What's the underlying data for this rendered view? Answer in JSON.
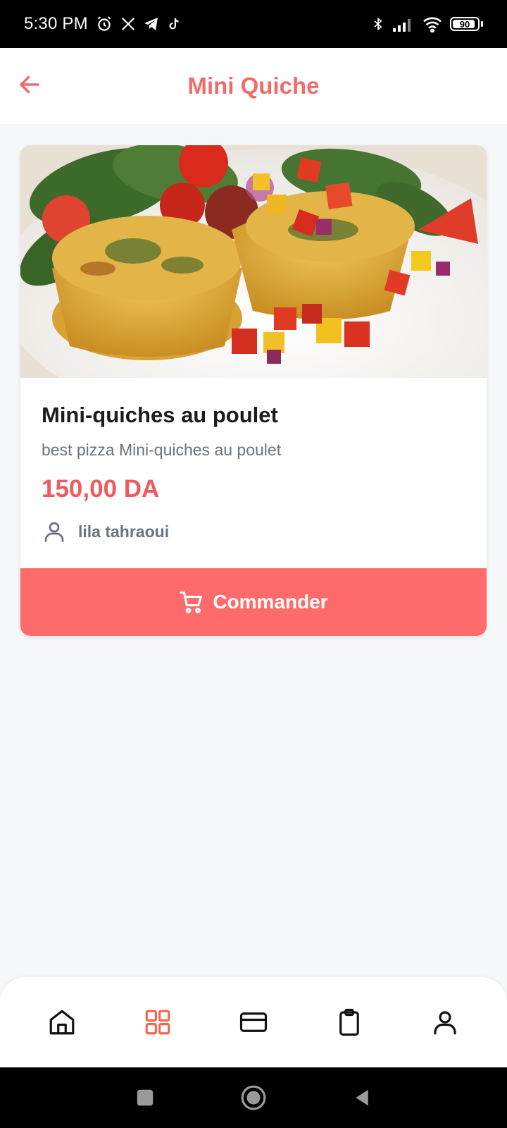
{
  "status_bar": {
    "time": "5:30 PM",
    "battery_level": "90",
    "battery_percent": 90,
    "icons": [
      "alarm-icon",
      "x-icon",
      "telegram-icon",
      "tiktok-icon",
      "bluetooth-icon",
      "signal-icon",
      "wifi-icon",
      "battery-icon"
    ]
  },
  "header": {
    "title": "Mini Quiche",
    "back_icon": "arrow-left-icon"
  },
  "product": {
    "image_icon": "food-photo",
    "name": "Mini-quiches au poulet",
    "description": "best pizza Mini-quiches au poulet",
    "price": "150,00 DA",
    "seller": "lila tahraoui",
    "seller_icon": "user-icon"
  },
  "order_button": {
    "label": "Commander",
    "icon": "cart-icon"
  },
  "bottom_nav": {
    "items": [
      {
        "icon": "home-icon",
        "active": false
      },
      {
        "icon": "grid-icon",
        "active": true
      },
      {
        "icon": "card-icon",
        "active": false
      },
      {
        "icon": "clipboard-icon",
        "active": false
      },
      {
        "icon": "profile-icon",
        "active": false
      }
    ]
  },
  "colors": {
    "accent": "#f26b6b",
    "button": "#ff6b6b",
    "price": "#ee5a5d",
    "muted": "#6b7280",
    "nav_active": "#f0694f"
  }
}
